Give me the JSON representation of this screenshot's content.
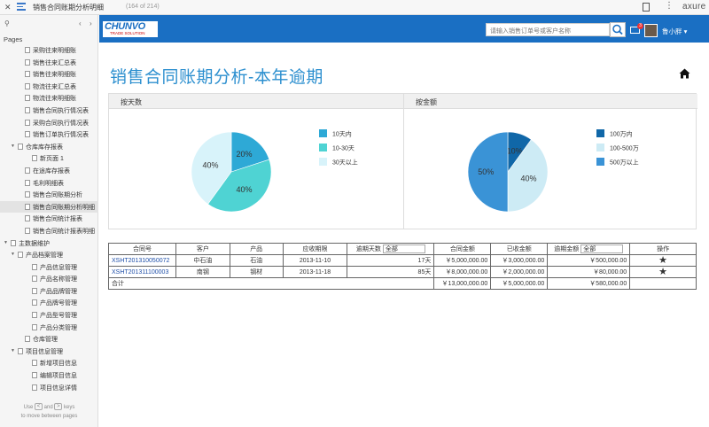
{
  "topbar": {
    "title": "销售合同账期分析明细",
    "page_count": "(164 of 214)",
    "more_icon": "⋮",
    "brand": "axure"
  },
  "sidebar": {
    "heading": "Pages",
    "items": [
      {
        "label": "采购往来明细账",
        "level": 2,
        "type": "page"
      },
      {
        "label": "销售往来汇总表",
        "level": 2,
        "type": "page"
      },
      {
        "label": "销售往来明细账",
        "level": 2,
        "type": "page"
      },
      {
        "label": "物流往来汇总表",
        "level": 2,
        "type": "page"
      },
      {
        "label": "物流往来明细账",
        "level": 2,
        "type": "page"
      },
      {
        "label": "销售合同执行情况表",
        "level": 2,
        "type": "page"
      },
      {
        "label": "采购合同执行情况表",
        "level": 2,
        "type": "page"
      },
      {
        "label": "销售订单执行情况表",
        "level": 2,
        "type": "page"
      },
      {
        "label": "仓库库存报表",
        "level": 1,
        "type": "folder"
      },
      {
        "label": "新页面 1",
        "level": 3,
        "type": "page"
      },
      {
        "label": "在途库存报表",
        "level": 2,
        "type": "page"
      },
      {
        "label": "毛利明细表",
        "level": 2,
        "type": "page"
      },
      {
        "label": "销售合同账期分析",
        "level": 2,
        "type": "page"
      },
      {
        "label": "销售合同账期分析明细",
        "level": 2,
        "type": "page",
        "active": true
      },
      {
        "label": "销售合同统计报表",
        "level": 2,
        "type": "page"
      },
      {
        "label": "销售合同统计报表明细",
        "level": 2,
        "type": "page"
      },
      {
        "label": "主数据维护",
        "level": 0,
        "type": "folder"
      },
      {
        "label": "产品档案管理",
        "level": 1,
        "type": "folder"
      },
      {
        "label": "产品信息管理",
        "level": 3,
        "type": "page"
      },
      {
        "label": "产品名称管理",
        "level": 3,
        "type": "page"
      },
      {
        "label": "产品品牌管理",
        "level": 3,
        "type": "page"
      },
      {
        "label": "产品牌号管理",
        "level": 3,
        "type": "page"
      },
      {
        "label": "产品型号管理",
        "level": 3,
        "type": "page"
      },
      {
        "label": "产品分类管理",
        "level": 3,
        "type": "page"
      },
      {
        "label": "仓库管理",
        "level": 2,
        "type": "page"
      },
      {
        "label": "项目信息管理",
        "level": 1,
        "type": "folder"
      },
      {
        "label": "新增项目信息",
        "level": 3,
        "type": "page"
      },
      {
        "label": "编辑项目信息",
        "level": 3,
        "type": "page"
      },
      {
        "label": "项目信息详情",
        "level": 3,
        "type": "page"
      }
    ],
    "footer_use": "Use",
    "footer_and": "and",
    "footer_keys": "keys",
    "footer_line2": "to move between pages",
    "key_left": "<",
    "key_right": ">"
  },
  "header": {
    "logo_text": "CHUNVO",
    "logo_sub": "TRADE SOLUTION",
    "search_placeholder": "请输入销售订单号或客户名称",
    "mail_badge": "3",
    "username": "鲁小胖 ▾"
  },
  "page": {
    "title": "销售合同账期分析-本年逾期"
  },
  "charts": {
    "days_header": "按天数",
    "amount_header": "按金额"
  },
  "chart_data": [
    {
      "type": "pie",
      "title": "按天数",
      "categories": [
        "10天内",
        "10-30天",
        "30天以上"
      ],
      "values": [
        20,
        40,
        40
      ],
      "labels": [
        "20%",
        "40%",
        "40%"
      ],
      "colors": [
        "#2ea9d6",
        "#4fd3d3",
        "#d8f3fa"
      ],
      "legend": "right"
    },
    {
      "type": "pie",
      "title": "按金额",
      "categories": [
        "100万内",
        "100-500万",
        "500万以上"
      ],
      "values": [
        10,
        40,
        50
      ],
      "labels": [
        "10%",
        "40%",
        "50%"
      ],
      "colors": [
        "#1067a8",
        "#cdebf5",
        "#3a93d6"
      ],
      "legend": "right"
    }
  ],
  "table": {
    "headers": {
      "contract_no": "合同号",
      "customer": "客户",
      "product": "产品",
      "due_date": "应收期限",
      "overdue_days": "逾期天数",
      "days_filter": "全部",
      "contract_amount": "合同金额",
      "received": "已收金额",
      "overdue_amount": "逾期金额",
      "amount_filter": "全部",
      "action": "操作"
    },
    "rows": [
      {
        "contract_no": "XSHT201310050072",
        "customer": "中石油",
        "product": "石油",
        "due_date": "2013-11-10",
        "overdue_days": "17天",
        "contract_amount": "￥5,000,000.00",
        "received": "￥3,000,000.00",
        "overdue_amount": "￥500,000.00",
        "action": "★"
      },
      {
        "contract_no": "XSHT201311100003",
        "customer": "南钢",
        "product": "钢材",
        "due_date": "2013-11-18",
        "overdue_days": "85天",
        "contract_amount": "￥8,000,000.00",
        "received": "￥2,000,000.00",
        "overdue_amount": "￥80,000.00",
        "action": "★"
      }
    ],
    "total": {
      "label": "合计",
      "contract_amount": "￥13,000,000.00",
      "received": "￥5,000,000.00",
      "overdue_amount": "￥580,000.00"
    }
  }
}
